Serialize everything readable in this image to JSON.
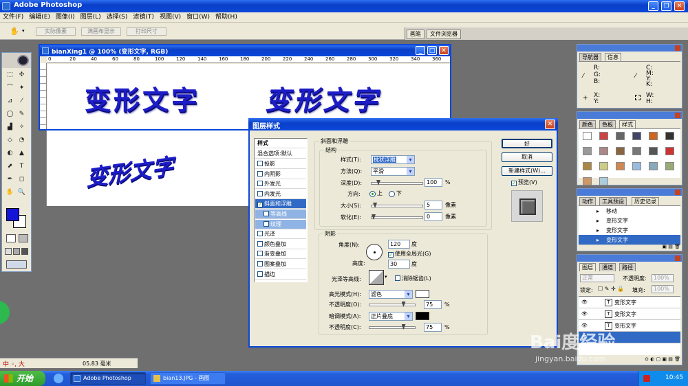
{
  "app": {
    "title": "Adobe Photoshop"
  },
  "menu": [
    "文件(F)",
    "编辑(E)",
    "图像(I)",
    "图层(L)",
    "选择(S)",
    "滤镜(T)",
    "视图(V)",
    "窗口(W)",
    "帮助(H)"
  ],
  "options_bar": {
    "actual_pixels": "实际像素",
    "fit_screen": "满画布显示",
    "print_size": "打印尺寸"
  },
  "palette_well": {
    "brushes": "画笔",
    "file_browser": "文件浏览器"
  },
  "doc": {
    "title": "bianXing1 @ 100% (变形文字, RGB)",
    "ruler_h": [
      "0",
      "20",
      "40",
      "60",
      "80",
      "100",
      "120",
      "140",
      "160",
      "180",
      "200",
      "220",
      "240",
      "260",
      "280",
      "300",
      "320",
      "340",
      "360",
      "380"
    ],
    "text_a": "变形文字",
    "text_b": "变形文字",
    "text_c": "变形文字",
    "zoom_status": "05.83 毫米"
  },
  "dialog": {
    "title": "图层样式",
    "styles_header": "样式",
    "blend_default": "混合选项:默认",
    "styles": [
      {
        "label": "投影",
        "checked": false
      },
      {
        "label": "内阴影",
        "checked": false
      },
      {
        "label": "外发光",
        "checked": false
      },
      {
        "label": "内发光",
        "checked": false
      },
      {
        "label": "斜面和浮雕",
        "checked": true
      },
      {
        "label": "等高线",
        "checked": false
      },
      {
        "label": "纹理",
        "checked": false
      },
      {
        "label": "光泽",
        "checked": false
      },
      {
        "label": "颜色叠加",
        "checked": false
      },
      {
        "label": "渐变叠加",
        "checked": false
      },
      {
        "label": "图案叠加",
        "checked": false
      },
      {
        "label": "描边",
        "checked": false
      }
    ],
    "bevel_title": "斜面和浮雕",
    "structure_title": "结构",
    "style_label": "样式(T):",
    "style_value": "枕状浮雕",
    "technique_label": "方法(Q):",
    "technique_value": "平滑",
    "depth_label": "深度(D):",
    "depth_value": "100",
    "depth_unit": "%",
    "depth_fraction": 0.1,
    "direction_label": "方向:",
    "dir_up": "上",
    "dir_down": "下",
    "size_label": "大小(S):",
    "size_value": "5",
    "size_unit": "像素",
    "size_fraction": 0.03,
    "soften_label": "软化(E):",
    "soften_value": "0",
    "soften_unit": "像素",
    "soften_fraction": 0.0,
    "shading_title": "阴影",
    "angle_label": "角度(N):",
    "angle_value": "120",
    "angle_unit": "度",
    "global_light": "使用全局光(G)",
    "altitude_label": "高度:",
    "altitude_value": "30",
    "altitude_unit": "度",
    "gloss_label": "光泽等高线:",
    "anti_alias": "消除锯齿(L)",
    "highlight_label": "高光模式(H):",
    "highlight_value": "滤色",
    "highlight_color": "#ffffff",
    "hl_opacity_label": "不透明度(O):",
    "hl_opacity_value": "75",
    "hl_opacity_fraction": 0.75,
    "shadow_label": "暗调模式(A):",
    "shadow_value": "正片叠底",
    "shadow_color": "#000000",
    "sh_opacity_label": "不透明度(C):",
    "sh_opacity_value": "75",
    "sh_opacity_fraction": 0.75,
    "pct": "%",
    "ok": "好",
    "cancel": "取消",
    "new_style": "新建样式(W)...",
    "preview": "预览(V)"
  },
  "navigator": {
    "tab_nav": "导航器",
    "tab_info": "信息",
    "r": "R:",
    "g": "G:",
    "b": "B:",
    "c": "C:",
    "m": "M:",
    "y": "Y:",
    "k": "K:",
    "x": "X:",
    "y2": "Y:",
    "w": "W:",
    "h": "H:"
  },
  "color_panel": {
    "tab_color": "颜色",
    "tab_swatch": "色板",
    "tab_style": "样式"
  },
  "history_panel": {
    "tab_action": "动作",
    "tab_presets": "工具预设",
    "tab_history": "历史记录",
    "items": [
      {
        "label": "移动",
        "selected": false
      },
      {
        "label": "变形文字",
        "selected": false
      },
      {
        "label": "变形文字",
        "selected": false
      },
      {
        "label": "变形文字",
        "selected": true
      }
    ]
  },
  "layers_panel": {
    "tab_layers": "图层",
    "tab_channels": "通道",
    "tab_paths": "路径",
    "blend": "正常",
    "opacity_label": "不透明度:",
    "opacity_value": "100%",
    "lock_label": "锁定:",
    "fill_label": "填充:",
    "fill_value": "100%",
    "layers": [
      {
        "label": "变形文字",
        "selected": false
      },
      {
        "label": "变形文字",
        "selected": false
      },
      {
        "label": "变形文字",
        "selected": false
      },
      {
        "label": "",
        "selected": true
      }
    ]
  },
  "ime": {
    "text": "中 ◦, 大"
  },
  "taskbar": {
    "start": "开始",
    "task1": "Adobe Photoshop",
    "task2": "bian13.JPG - 画图",
    "clock": "10:45"
  },
  "watermark": {
    "line1": "Bai度经验",
    "line2": "jingyan.baidu.com"
  },
  "colors": {
    "foreground": "#1414d8",
    "background": "#ffffff",
    "text_blue": "#1d1dc8",
    "xp_blue": "#0a46d6"
  }
}
